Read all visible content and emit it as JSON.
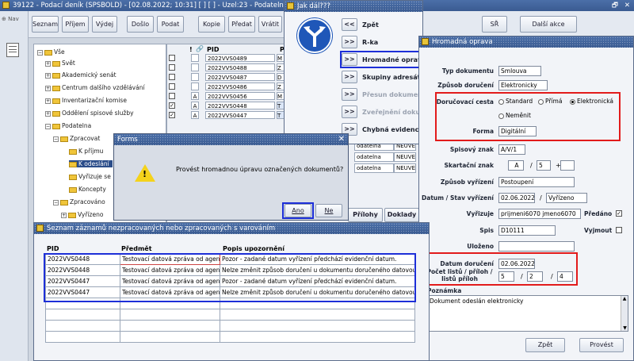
{
  "main_window": {
    "title": "39122 - Podací deník (SPSBOLD) - [02.08.2022; 10:31]  [ ] [ ] - Uzel:23 - Podatelna",
    "nav_label": "Nav",
    "toolbar": [
      "Seznam",
      "Příjem",
      "Výdej",
      "Došlo",
      "Podat",
      "Kopie",
      "Předat",
      "Vrátit"
    ],
    "right_tabs": [
      "SŘ",
      "Další akce"
    ],
    "restore_glyph": "🗗",
    "close_glyph": "✕"
  },
  "tree": [
    {
      "label": "Vše",
      "level": 0
    },
    {
      "label": "Svět",
      "level": 1
    },
    {
      "label": "Akademický senát",
      "level": 1
    },
    {
      "label": "Centrum dalšího vzdělávání",
      "level": 1
    },
    {
      "label": "Inventarizační komise",
      "level": 1
    },
    {
      "label": "Oddělení spisové služby",
      "level": 1
    },
    {
      "label": "Podatelna",
      "level": 1
    },
    {
      "label": "Zpracovat",
      "level": 2
    },
    {
      "label": "K příjmu",
      "level": 3
    },
    {
      "label": "K odeslání",
      "level": 3
    },
    {
      "label": "Vyřizuje se",
      "level": 3
    },
    {
      "label": "Koncepty",
      "level": 3
    },
    {
      "label": "Zpracováno",
      "level": 2
    },
    {
      "label": "Vyřízeno",
      "level": 3
    }
  ],
  "list": {
    "header_excl": "!",
    "header_pid": "PID",
    "header_p": "P",
    "rows": [
      {
        "flag": "",
        "pid": "2022VVS0489",
        "p": "M"
      },
      {
        "flag": "",
        "pid": "2022VVS0488",
        "p": "Z"
      },
      {
        "flag": "",
        "pid": "2022VVS0487",
        "p": "D"
      },
      {
        "flag": "",
        "pid": "2022VVS0486",
        "p": "Z"
      },
      {
        "flag": "A",
        "pid": "2022VVS0456",
        "p": "M"
      },
      {
        "flag": "A",
        "pid": "2022VVS0448",
        "p": "T"
      },
      {
        "flag": "A",
        "pid": "2022VVS0447",
        "p": "T"
      }
    ],
    "right_cells": [
      [
        "odatelna",
        "NEUVE"
      ],
      [
        "odatelna",
        "NEUVE"
      ],
      [
        "odatelna",
        "NEUVE"
      ],
      [
        "odatelna",
        "NEUVE"
      ]
    ],
    "bottom_tabs": [
      "Přílohy",
      "Doklady"
    ]
  },
  "jak_dal": {
    "title": "Jak dál???",
    "items": [
      {
        "arrow": "<<",
        "label": "Zpět"
      },
      {
        "arrow": ">>",
        "label": "R-ka"
      },
      {
        "arrow": ">>",
        "label": "Hromadné opravy"
      },
      {
        "arrow": ">>",
        "label": "Skupiny adresátů"
      },
      {
        "arrow": ">>",
        "label": "Přesun dokumen"
      },
      {
        "arrow": ">>",
        "label": "Zveřejnění dokum"
      },
      {
        "arrow": ">>",
        "label": "Chybná evidence"
      }
    ]
  },
  "forms_dialog": {
    "title": "Forms",
    "message": "Provést hromadnou úpravu označených dokumentů?",
    "yes": "Ano",
    "no": "Ne"
  },
  "hromadna": {
    "title": "Hromadná oprava",
    "labels": {
      "typ": "Typ dokumentu",
      "zpusob": "Způsob doručení",
      "cesta": "Doručovací cesta",
      "forma": "Forma",
      "spisovy": "Spisový znak",
      "skartacni": "Skartační znak",
      "zpusob_vyrizeni": "Způsob vyřízení",
      "datum_stav": "Datum / Stav vyřízení",
      "vyrizuje": "Vyřizuje",
      "predano": "Předáno",
      "spis": "Spis",
      "vyjmout": "Vyjmout",
      "ulozeno": "Uloženo",
      "datum_doruceni": "Datum doručení",
      "pocet": "Počet listů / příloh / listů příloh",
      "poznamka": "Poznámka"
    },
    "values": {
      "typ": "Smlouva",
      "zpusob": "Elektronicky",
      "cesta_options": [
        "Standard",
        "Přímá",
        "Elektronická",
        "Neměnit"
      ],
      "cesta_selected": "Elektronická",
      "forma": "Digitální",
      "spisovy": "A/V/1",
      "skartacni_a": "A",
      "skartacni_sep1": "/",
      "skartacni_b": "5",
      "skartacni_sep2": "+",
      "skartacni_c": "",
      "zpusob_vyrizeni": "Postoupení",
      "datum": "02.06.2022",
      "stav_sep": "/",
      "stav": "Vyřízeno",
      "vyrizuje": "prijmeni6070 jmeno6070",
      "predano_checked": true,
      "spis": "D10111",
      "vyjmout_checked": false,
      "ulozeno": "",
      "datum_doruceni": "02.06.2022",
      "pocet_1": "5",
      "pocet_sep1": "/",
      "pocet_2": "2",
      "pocet_sep2": "/",
      "pocet_3": "4",
      "poznamka": "Dokument odeslán elektronicky"
    },
    "buttons": {
      "back": "Zpět",
      "do": "Provést"
    }
  },
  "seznam": {
    "title": "Seznam záznamů nezpracovaných nebo zpracovaných s varováním",
    "headers": [
      "PID",
      "Předmět",
      "Popis upozornění"
    ],
    "rows": [
      {
        "pid": "2022VVS0448",
        "predmet": "Testovací datová zpráva od agent",
        "popis": "Pozor - zadané datum vyřízení předchází evidenční datum."
      },
      {
        "pid": "2022VVS0448",
        "predmet": "Testovací datová zpráva od agent",
        "popis": "Nelze změnit způsob doručení u dokumentu doručeného datovou"
      },
      {
        "pid": "2022VVS0447",
        "predmet": "Testovací datová zpráva od agent",
        "popis": "Pozor - zadané datum vyřízení předchází evidenční datum."
      },
      {
        "pid": "2022VVS0447",
        "predmet": "Testovací datová zpráva od agent",
        "popis": "Nelze změnit způsob doručení u dokumentu doručeného datovou"
      }
    ]
  }
}
